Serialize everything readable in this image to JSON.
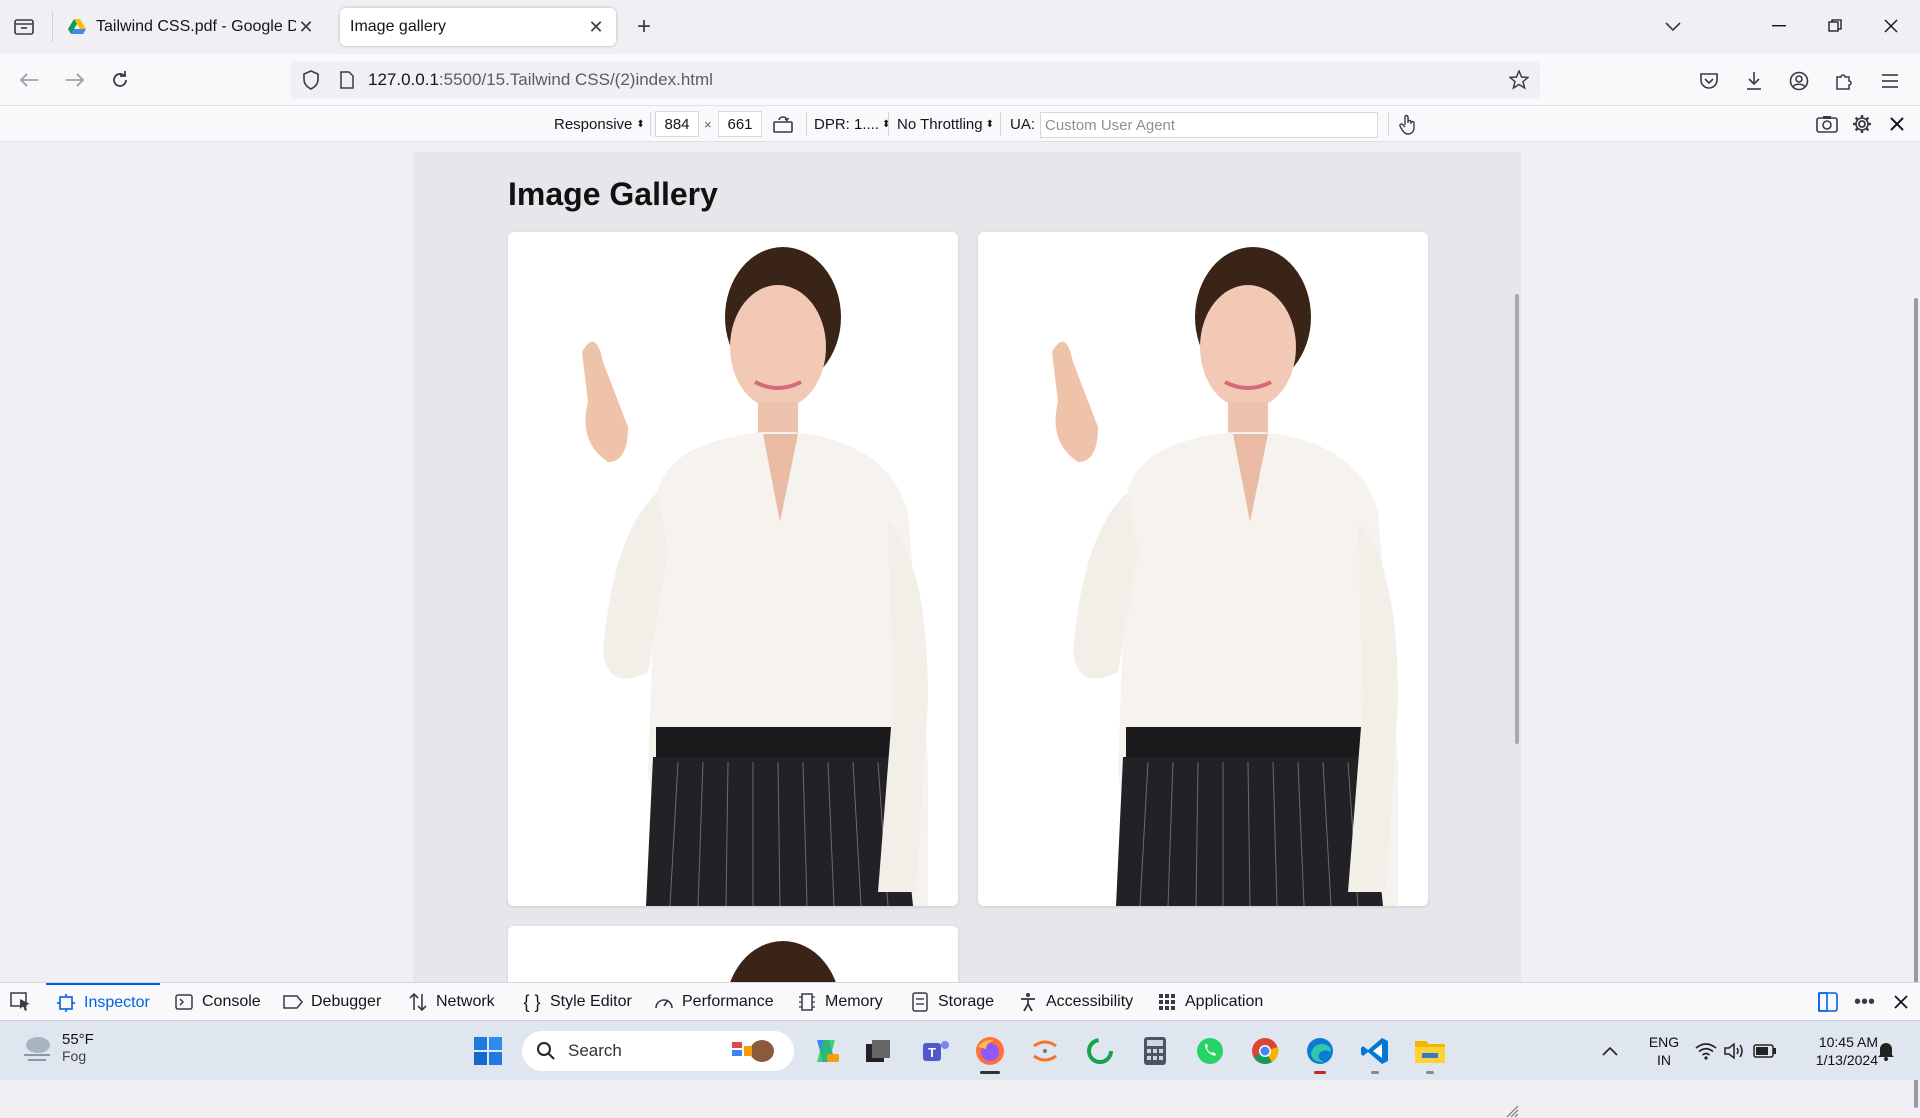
{
  "browser": {
    "tabs": [
      {
        "title": "Tailwind CSS.pdf - Google Drive",
        "active": false
      },
      {
        "title": "Image gallery",
        "active": true
      }
    ],
    "url": {
      "host": "127.0.0.1",
      "path": ":5500/15.Tailwind CSS/(2)index.html"
    }
  },
  "rdm": {
    "device": "Responsive",
    "width": "884",
    "times": "×",
    "height": "661",
    "dpr": "DPR: 1....",
    "throttling": "No Throttling",
    "ua_label": "UA:",
    "ua_placeholder": "Custom User Agent"
  },
  "page": {
    "heading": "Image Gallery"
  },
  "devtools": {
    "tabs": [
      "Inspector",
      "Console",
      "Debugger",
      "Network",
      "Style Editor",
      "Performance",
      "Memory",
      "Storage",
      "Accessibility",
      "Application"
    ],
    "selected": "Inspector"
  },
  "taskbar": {
    "weather_temp": "55°F",
    "weather_cond": "Fog",
    "search": "Search",
    "lang": "ENG",
    "region": "IN",
    "time": "10:45 AM",
    "date": "1/13/2024"
  },
  "colors": {
    "accent": "#0061e0",
    "page_bg": "#e5e7eb"
  }
}
